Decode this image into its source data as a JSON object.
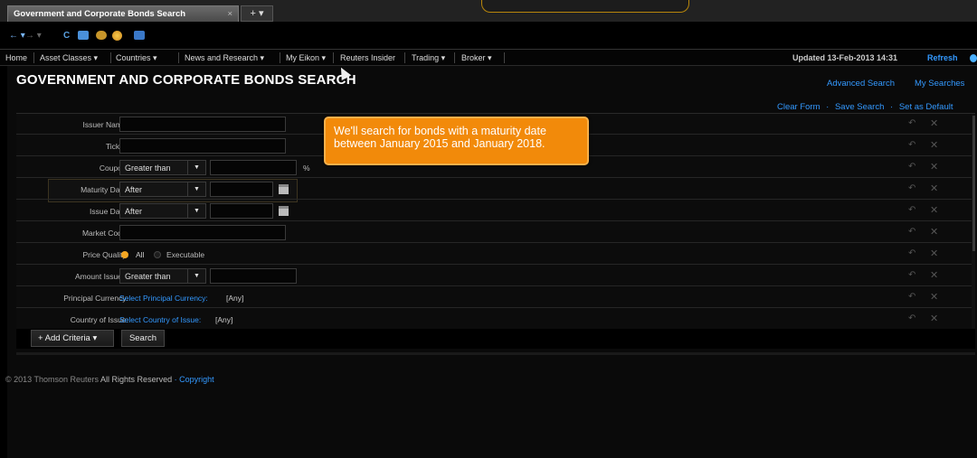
{
  "tab": {
    "title": "Government and Corporate Bonds Search",
    "close": "×",
    "add": "+ ▾"
  },
  "menubar": {
    "items": [
      "Home",
      "Asset Classes ▾",
      "Countries ▾",
      "News and Research ▾",
      "My Eikon ▾",
      "Reuters Insider",
      "Trading ▾",
      "Broker ▾"
    ],
    "updated": "Updated 13-Feb-2013 14:31",
    "refresh": "Refresh"
  },
  "page": {
    "title": "GOVERNMENT AND CORPORATE BONDS SEARCH"
  },
  "header_links": {
    "advanced_search": "Advanced Search",
    "my_searches": "My Searches"
  },
  "form_links": {
    "clear": "Clear Form",
    "save": "Save Search",
    "default": "Set as Default",
    "sep": "·"
  },
  "form": {
    "issuer_name": {
      "label": "Issuer Name:",
      "value": ""
    },
    "ticker": {
      "label": "Ticker:",
      "value": ""
    },
    "coupon": {
      "label": "Coupon:",
      "operator": "Greater than",
      "unit": "%",
      "value": ""
    },
    "maturity_date": {
      "label": "Maturity Date:",
      "operator": "After",
      "value": ""
    },
    "issue_date": {
      "label": "Issue Date:",
      "operator": "After",
      "value": ""
    },
    "market_code": {
      "label": "Market Code:",
      "value": ""
    },
    "price_quality": {
      "label": "Price Quality:",
      "options": [
        "All",
        "Executable"
      ],
      "selected": "All"
    },
    "amount_issued": {
      "label": "Amount Issued:",
      "operator": "Greater than",
      "value": ""
    },
    "principal_currency": {
      "label": "Principal Currency:",
      "link": "Select Principal Currency:",
      "value": "[Any]"
    },
    "country_of_issue": {
      "label": "Country of Issue:",
      "link": "Select Country of Issue:",
      "value": "[Any]"
    }
  },
  "buttons": {
    "add_criteria": "+ Add Criteria ▾",
    "search": "Search"
  },
  "footer": {
    "copyright": "© 2013 Thomson Reuters",
    "rights": "All Rights Reserved",
    "sep": "·",
    "link": "Copyright"
  },
  "callout": {
    "text": "We'll search for bonds with a maturity date between January 2015 and January 2018."
  },
  "colors": {
    "accent_link": "#3399ff",
    "callout_bg": "#f28a0a",
    "radio_selected": "#f5a623"
  },
  "icons": {
    "undo": "undo-icon",
    "remove": "close-icon",
    "calendar": "calendar-icon",
    "dropdown": "chevron-down-icon"
  }
}
